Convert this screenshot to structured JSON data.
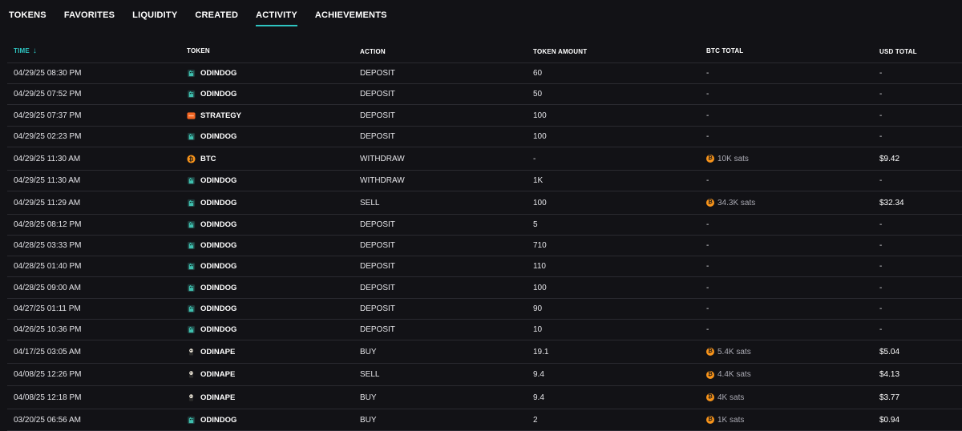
{
  "tabs": [
    {
      "label": "TOKENS",
      "active": false
    },
    {
      "label": "FAVORITES",
      "active": false
    },
    {
      "label": "LIQUIDITY",
      "active": false
    },
    {
      "label": "CREATED",
      "active": false
    },
    {
      "label": "ACTIVITY",
      "active": true
    },
    {
      "label": "ACHIEVEMENTS",
      "active": false
    }
  ],
  "table": {
    "headers": {
      "time": "TIME",
      "time_sort_arrow": "↓",
      "token": "TOKEN",
      "action": "ACTION",
      "token_amount": "TOKEN AMOUNT",
      "btc_total": "BTC TOTAL",
      "usd_total": "USD TOTAL"
    },
    "rows": [
      {
        "time": "04/29/25 08:30 PM",
        "icon": "odindog-icon",
        "token": "ODINDOG",
        "action": "DEPOSIT",
        "amount": "60",
        "btc": "-",
        "usd": "-"
      },
      {
        "time": "04/29/25 07:52 PM",
        "icon": "odindog-icon",
        "token": "ODINDOG",
        "action": "DEPOSIT",
        "amount": "50",
        "btc": "-",
        "usd": "-"
      },
      {
        "time": "04/29/25 07:37 PM",
        "icon": "strategy-icon",
        "token": "STRATEGY",
        "action": "DEPOSIT",
        "amount": "100",
        "btc": "-",
        "usd": "-"
      },
      {
        "time": "04/29/25 02:23 PM",
        "icon": "odindog-icon",
        "token": "ODINDOG",
        "action": "DEPOSIT",
        "amount": "100",
        "btc": "-",
        "usd": "-"
      },
      {
        "time": "04/29/25 11:30 AM",
        "icon": "btc-icon",
        "token": "BTC",
        "action": "WITHDRAW",
        "amount": "-",
        "btc": "10K sats",
        "usd": "$9.42"
      },
      {
        "time": "04/29/25 11:30 AM",
        "icon": "odindog-icon",
        "token": "ODINDOG",
        "action": "WITHDRAW",
        "amount": "1K",
        "btc": "-",
        "usd": "-"
      },
      {
        "time": "04/29/25 11:29 AM",
        "icon": "odindog-icon",
        "token": "ODINDOG",
        "action": "SELL",
        "amount": "100",
        "btc": "34.3K sats",
        "usd": "$32.34"
      },
      {
        "time": "04/28/25 08:12 PM",
        "icon": "odindog-icon",
        "token": "ODINDOG",
        "action": "DEPOSIT",
        "amount": "5",
        "btc": "-",
        "usd": "-"
      },
      {
        "time": "04/28/25 03:33 PM",
        "icon": "odindog-icon",
        "token": "ODINDOG",
        "action": "DEPOSIT",
        "amount": "710",
        "btc": "-",
        "usd": "-"
      },
      {
        "time": "04/28/25 01:40 PM",
        "icon": "odindog-icon",
        "token": "ODINDOG",
        "action": "DEPOSIT",
        "amount": "110",
        "btc": "-",
        "usd": "-"
      },
      {
        "time": "04/28/25 09:00 AM",
        "icon": "odindog-icon",
        "token": "ODINDOG",
        "action": "DEPOSIT",
        "amount": "100",
        "btc": "-",
        "usd": "-"
      },
      {
        "time": "04/27/25 01:11 PM",
        "icon": "odindog-icon",
        "token": "ODINDOG",
        "action": "DEPOSIT",
        "amount": "90",
        "btc": "-",
        "usd": "-"
      },
      {
        "time": "04/26/25 10:36 PM",
        "icon": "odindog-icon",
        "token": "ODINDOG",
        "action": "DEPOSIT",
        "amount": "10",
        "btc": "-",
        "usd": "-"
      },
      {
        "time": "04/17/25 03:05 AM",
        "icon": "odinape-icon",
        "token": "ODINAPE",
        "action": "BUY",
        "amount": "19.1",
        "btc": "5.4K sats",
        "usd": "$5.04"
      },
      {
        "time": "04/08/25 12:26 PM",
        "icon": "odinape-icon",
        "token": "ODINAPE",
        "action": "SELL",
        "amount": "9.4",
        "btc": "4.4K sats",
        "usd": "$4.13"
      },
      {
        "time": "04/08/25 12:18 PM",
        "icon": "odinape-icon",
        "token": "ODINAPE",
        "action": "BUY",
        "amount": "9.4",
        "btc": "4K sats",
        "usd": "$3.77"
      },
      {
        "time": "03/20/25 06:56 AM",
        "icon": "odindog-icon",
        "token": "ODINDOG",
        "action": "BUY",
        "amount": "2",
        "btc": "1K sats",
        "usd": "$0.94"
      }
    ]
  },
  "colors": {
    "background": "#121216",
    "accent": "#2ec4c1",
    "btc_coin": "#f7931a",
    "strategy_token": "#f26522"
  },
  "btc_coin_glyph": "₿"
}
